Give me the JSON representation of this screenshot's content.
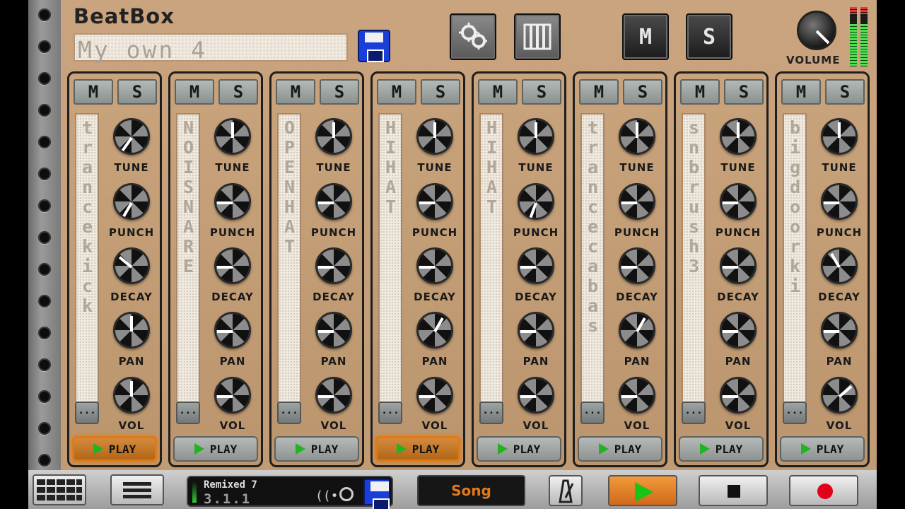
{
  "app": {
    "logo": "BeatBox",
    "pattern_name": "My own 4",
    "volume_label": "VOLUME"
  },
  "top_buttons": {
    "mute_label": "M",
    "solo_label": "S"
  },
  "channels": [
    {
      "name": "trancekick",
      "mute": "M",
      "solo": "S",
      "play": "PLAY",
      "playing": true
    },
    {
      "name": "NOISNARE",
      "mute": "M",
      "solo": "S",
      "play": "PLAY",
      "playing": false
    },
    {
      "name": "OPENHAT",
      "mute": "M",
      "solo": "S",
      "play": "PLAY",
      "playing": false
    },
    {
      "name": "HIHAT",
      "mute": "M",
      "solo": "S",
      "play": "PLAY",
      "playing": true
    },
    {
      "name": "HIHAT",
      "mute": "M",
      "solo": "S",
      "play": "PLAY",
      "playing": false
    },
    {
      "name": "trancecabas",
      "mute": "M",
      "solo": "S",
      "play": "PLAY",
      "playing": false
    },
    {
      "name": "snbrush3",
      "mute": "M",
      "solo": "S",
      "play": "PLAY",
      "playing": false
    },
    {
      "name": "bigdoorki",
      "mute": "M",
      "solo": "S",
      "play": "PLAY",
      "playing": false
    }
  ],
  "knob_labels": {
    "tune": "TUNE",
    "punch": "PUNCH",
    "decay": "DECAY",
    "pan": "PAN",
    "vol": "VOL"
  },
  "more_label": "...",
  "transport": {
    "status_title": "Remixed 7",
    "position": "3.1.1",
    "mode": "Song"
  },
  "colors": {
    "accent": "#e27a12",
    "panel": "#c9a37d",
    "play_green": "#22b322",
    "record": "#e3001b"
  }
}
